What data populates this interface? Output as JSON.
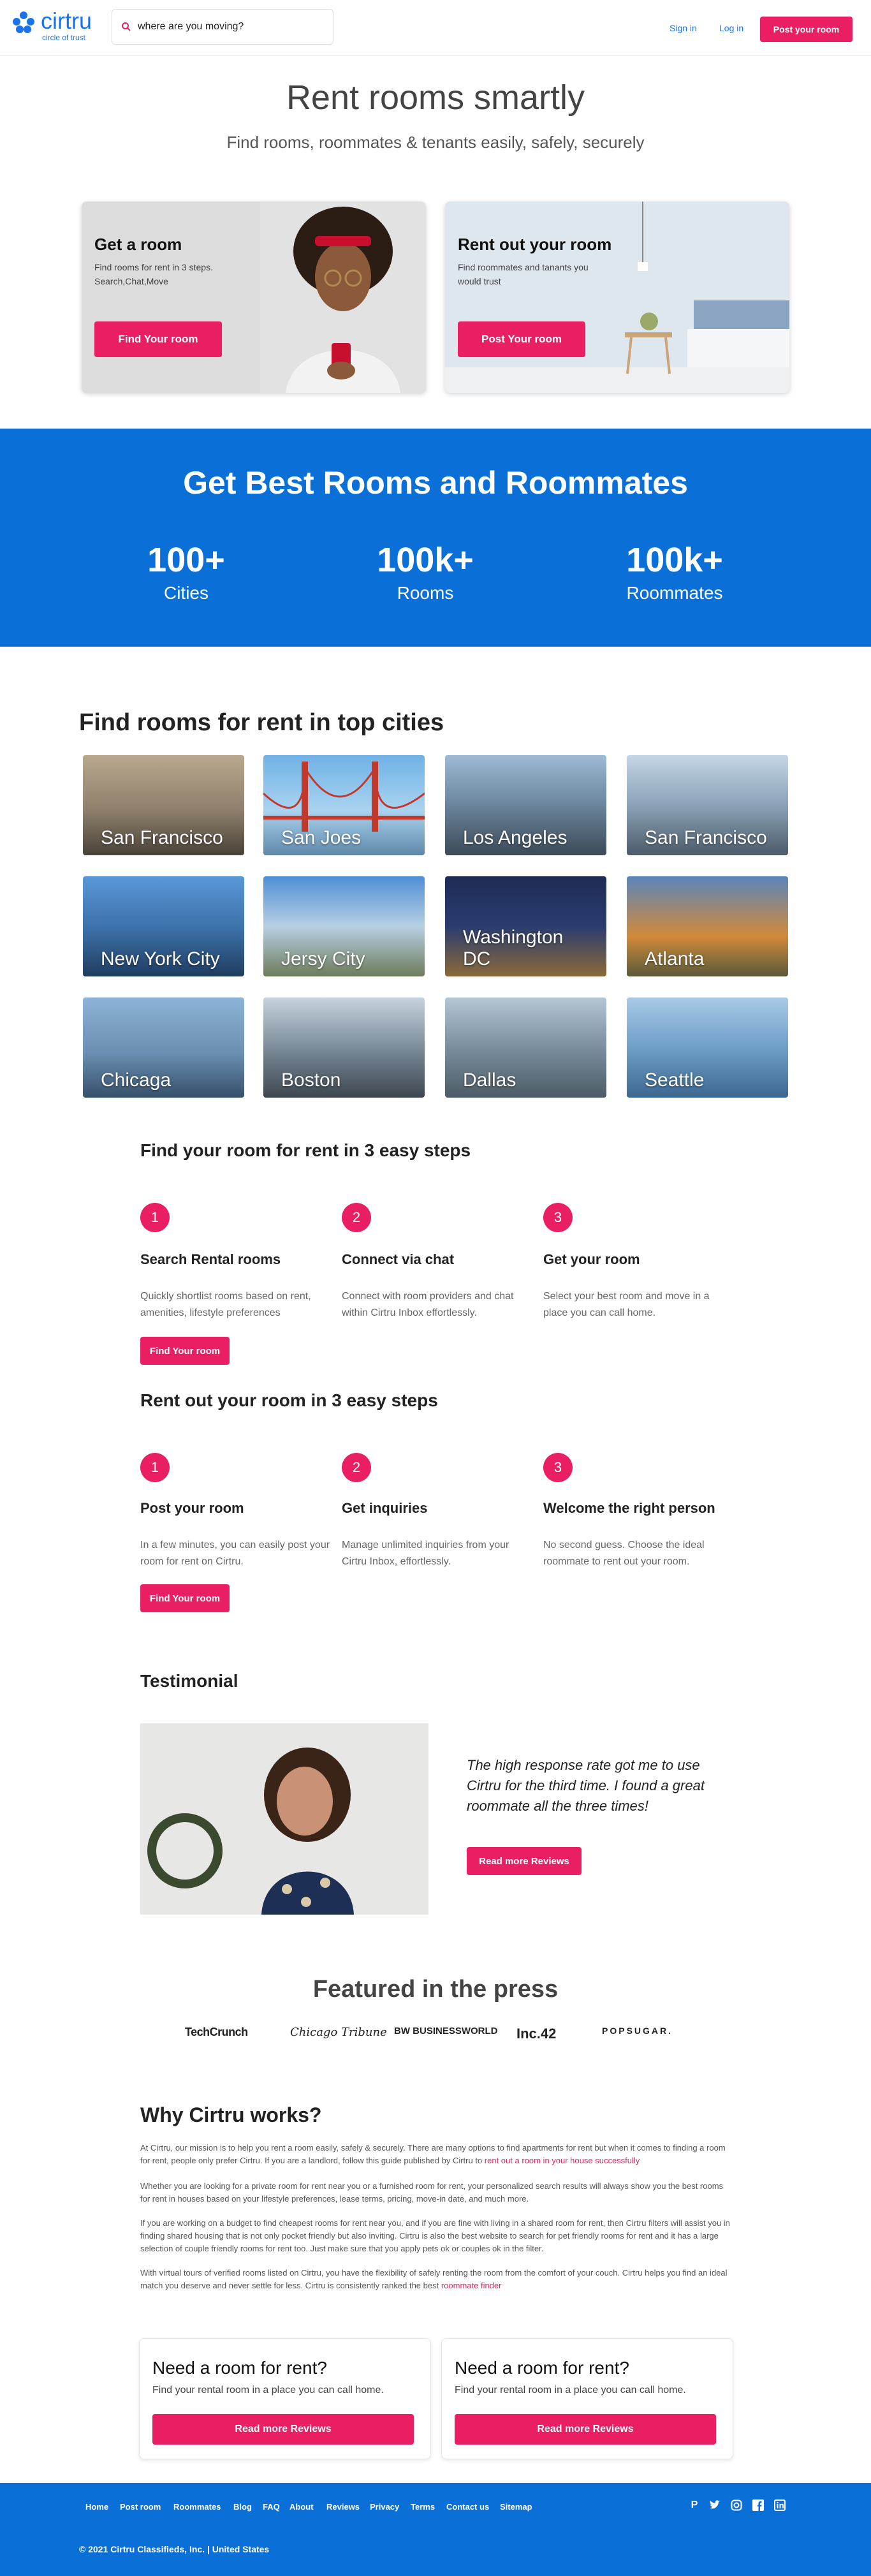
{
  "header": {
    "logo_text": "cirtru",
    "logo_sub": "circle of trust",
    "search_placeholder": "where are you moving?",
    "signin": "Sign in",
    "login": "Log in",
    "post": "Post your room"
  },
  "hero": {
    "title": "Rent rooms smartly",
    "subtitle": "Find rooms, roommates & tenants easily, safely, securely"
  },
  "cards": [
    {
      "title": "Get a room",
      "desc": "Find rooms for rent in 3 steps. Search,Chat,Move",
      "button": "Find Your room"
    },
    {
      "title": "Rent out your room",
      "desc": "Find roommates and tanants you would trust",
      "button": "Post Your room"
    }
  ],
  "stats": {
    "title": "Get Best Rooms and Roommates",
    "items": [
      {
        "number": "100+",
        "label": "Cities"
      },
      {
        "number": "100k+",
        "label": "Rooms"
      },
      {
        "number": "100k+",
        "label": "Roommates"
      }
    ]
  },
  "cities": {
    "title": "Find rooms for rent in top cities",
    "items": [
      "San Francisco",
      "San Joes",
      "Los Angeles",
      "San Francisco",
      "New York City",
      "Jersy City",
      "Washington DC",
      "Atlanta",
      "Chicaga",
      "Boston",
      "Dallas",
      "Seattle"
    ]
  },
  "steps_find": {
    "title": "Find your room for rent in 3 easy steps",
    "items": [
      {
        "num": "1",
        "title": "Search Rental rooms",
        "desc": "Quickly shortlist rooms based on rent, amenities, lifestyle preferences"
      },
      {
        "num": "2",
        "title": "Connect via chat",
        "desc": "Connect with room providers and chat within Cirtru Inbox effortlessly."
      },
      {
        "num": "3",
        "title": "Get your room",
        "desc": "Select your best room and move in a place you can call home."
      }
    ],
    "button": "Find Your room"
  },
  "steps_rent": {
    "title": "Rent out your room in 3 easy steps",
    "items": [
      {
        "num": "1",
        "title": "Post your room",
        "desc": "In a few minutes, you can easily post your room for rent on Cirtru."
      },
      {
        "num": "2",
        "title": "Get inquiries",
        "desc": "Manage unlimited inquiries from your Cirtru Inbox, effortlessly."
      },
      {
        "num": "3",
        "title": "Welcome the right person",
        "desc": "No second guess. Choose the ideal roommate to rent out your room."
      }
    ],
    "button": "Find Your room"
  },
  "testimonial": {
    "title": "Testimonial",
    "quote": "The high response rate got me to use Cirtru for the third time. I found a great roommate all the three times!",
    "button": "Read more Reviews"
  },
  "press": {
    "title": "Featured in the press",
    "logos": [
      "TechCrunch",
      "Chicago Tribune",
      "BW BUSINESSWORLD",
      "Inc.42",
      "POPSUGAR."
    ]
  },
  "why": {
    "title": "Why Cirtru works?",
    "p1": "At Cirtru, our mission is to help you rent a room easily, safely & securely. There are many options to find apartments for rent but when it comes to finding a room for rent, people only prefer Cirtru. If you are a landlord, follow this guide published by Cirtru to ",
    "p1_link": "rent out a room in your house successfully",
    "p2": "Whether you are looking for a private room for rent near you or a furnished room for rent, your personalized search results will always show you the best rooms for rent in houses based on your lifestyle preferences, lease terms, pricing, move-in date, and much more.",
    "p3": "If you are working on a budget to find cheapest rooms for rent near you, and if you are fine with living in a shared room for rent, then Cirtru filters will assist you in finding shared housing that is not only pocket friendly but also inviting. Cirtru is also the best website to search for pet friendly rooms for rent and it has a large selection of couple friendly rooms for rent too. Just make sure that you apply pets ok or couples ok in the filter.",
    "p4": "With virtual tours of verified rooms listed on Cirtru, you have the flexibility of safely renting the room from the comfort of your couch. Cirtru helps you find an ideal match you deserve and never settle for less. Cirtru is consistently ranked the best ",
    "p4_link": "roommate finder"
  },
  "ctas": [
    {
      "title": "Need a room for rent?",
      "desc": "Find your rental room in a place you can call home.",
      "button": "Read more Reviews"
    },
    {
      "title": "Need a room for rent?",
      "desc": "Find your rental room in a place you can call home.",
      "button": "Read more Reviews"
    }
  ],
  "footer": {
    "links": [
      "Home",
      "Post room",
      "Roommates",
      "Blog",
      "FAQ",
      "About",
      "Reviews",
      "Privacy",
      "Terms",
      "Contact us",
      "Sitemap"
    ],
    "copyright": "© 2021 Cirtru Classifieds, Inc. | United States"
  },
  "colors": {
    "brand_blue": "#0a6fd6",
    "accent_pink": "#e91e63"
  }
}
